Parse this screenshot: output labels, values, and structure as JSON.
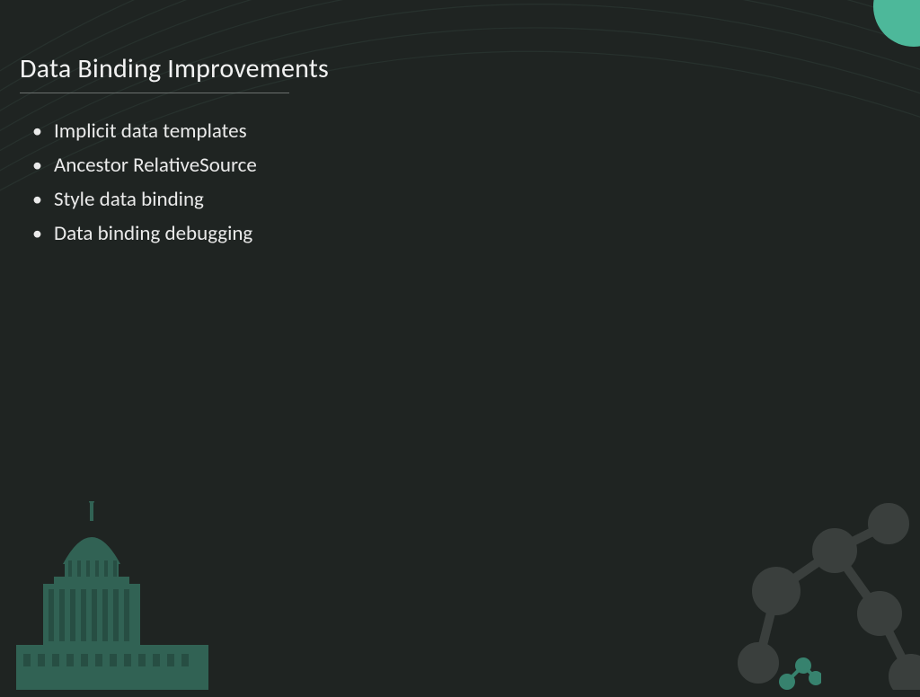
{
  "slide": {
    "title": "Data Binding Improvements",
    "bullets": [
      "Implicit data templates",
      "Ancestor RelativeSource",
      "Style data binding",
      "Data binding debugging"
    ]
  },
  "theme": {
    "accent": "#4db89a",
    "background": "#1f2422"
  }
}
